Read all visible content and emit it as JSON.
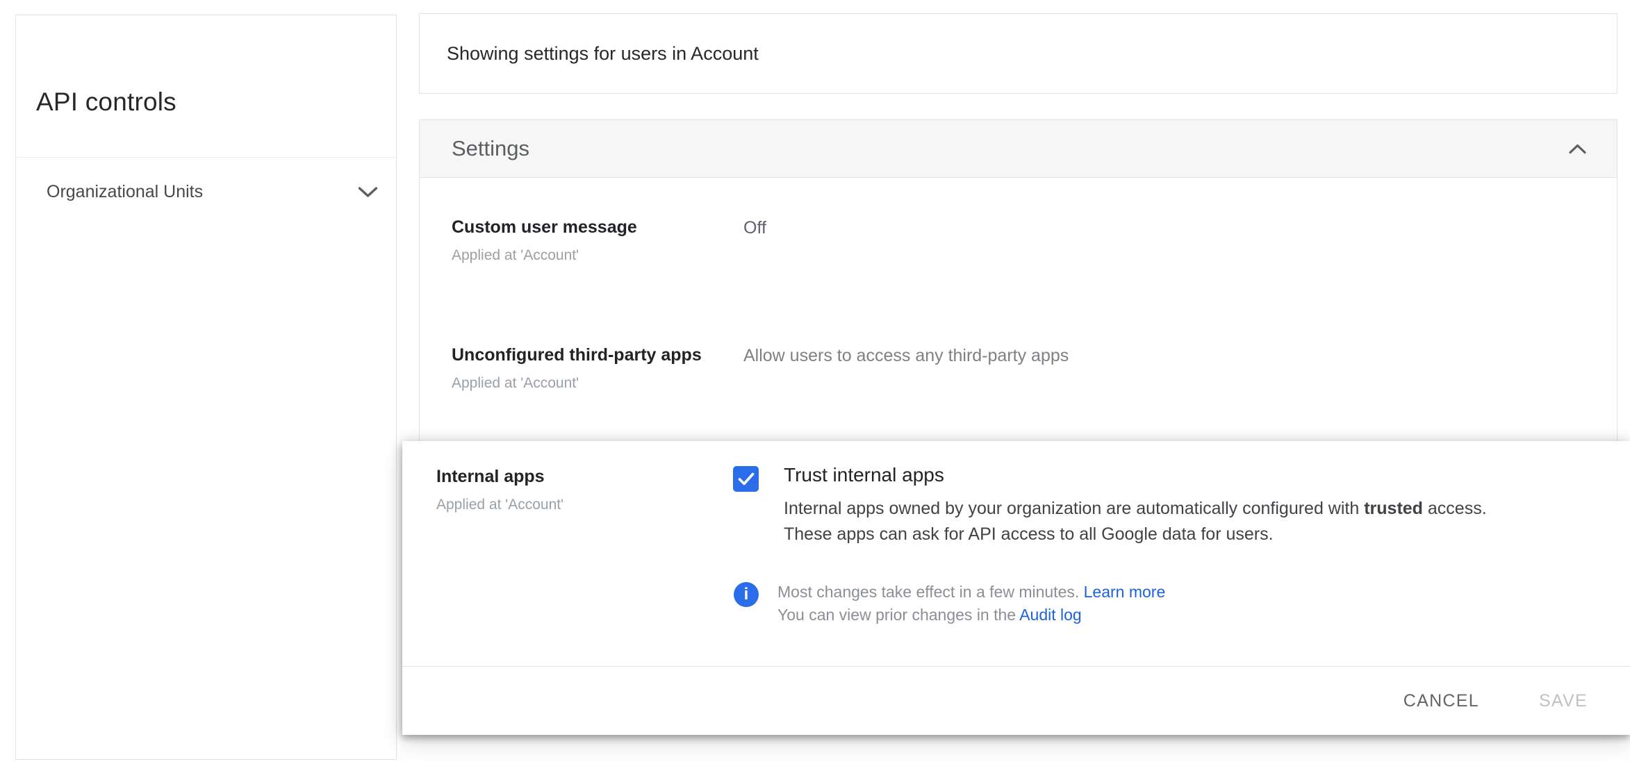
{
  "sidebar": {
    "title": "API controls",
    "items": [
      {
        "label": "Organizational Units"
      }
    ]
  },
  "header": {
    "scope_text": "Showing settings for users in Account"
  },
  "settings": {
    "section_title": "Settings",
    "rows": [
      {
        "label": "Custom user message",
        "applied_at": "Applied at 'Account'",
        "value": "Off"
      },
      {
        "label": "Unconfigured third-party apps",
        "applied_at": "Applied at 'Account'",
        "value": "Allow users to access any third-party apps"
      }
    ]
  },
  "dialog": {
    "label": "Internal apps",
    "applied_at": "Applied at 'Account'",
    "checkbox": {
      "checked": true,
      "label": "Trust internal apps"
    },
    "description": {
      "line1_pre": "Internal apps owned by your organization are automatically configured with ",
      "line1_bold": "trusted",
      "line1_post": " access.",
      "line2": "These apps can ask for API access to all Google data for users."
    },
    "info": {
      "icon_glyph": "i",
      "line1_text": "Most changes take effect in a few minutes. ",
      "line1_link": "Learn more",
      "line2_text": "You can view prior changes in the ",
      "line2_link": "Audit log"
    },
    "buttons": {
      "cancel": "CANCEL",
      "save": "SAVE"
    }
  },
  "colors": {
    "accent_blue": "#2b6de8",
    "link_blue": "#1b63dd"
  }
}
